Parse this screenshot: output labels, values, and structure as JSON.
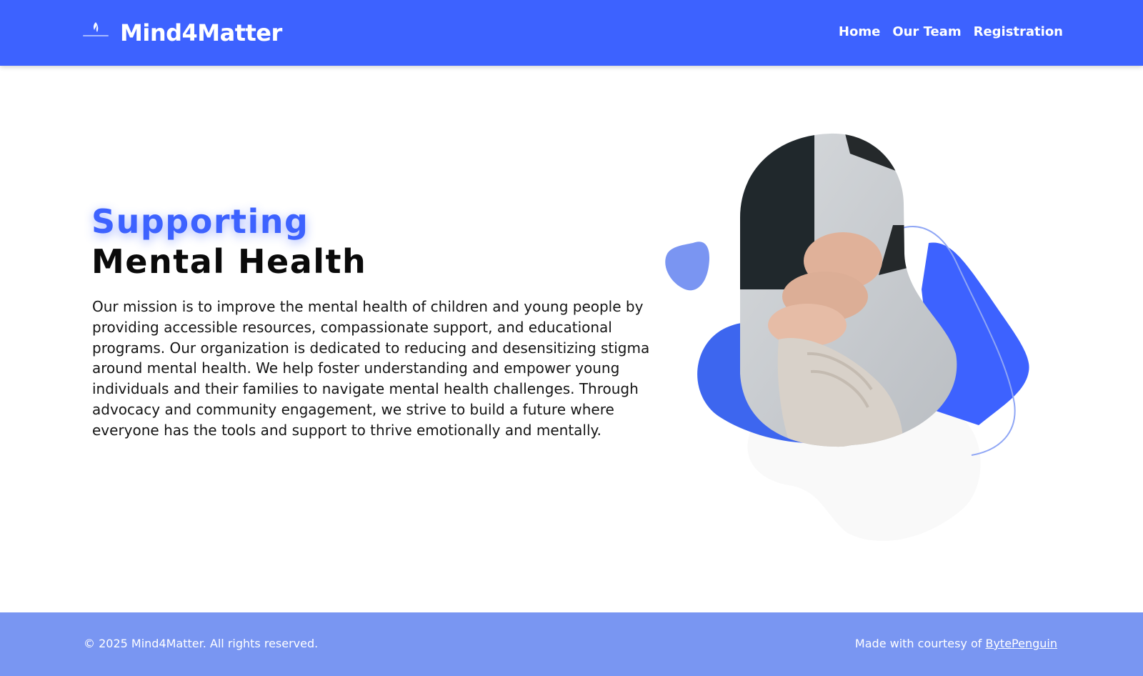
{
  "header": {
    "brand": "Mind4Matter",
    "logo_icon": "mind4matter-logo",
    "nav": [
      {
        "label": "Home"
      },
      {
        "label": "Our Team"
      },
      {
        "label": "Registration"
      }
    ]
  },
  "hero": {
    "line1": "Supporting",
    "line2": "Mental Health",
    "mission": "Our mission is to improve the mental health of children and young people by providing accessible resources, compassionate support, and educational programs. Our organization is dedicated to reducing and desensitizing stigma around mental health. We help foster understanding and empower young individuals and their families to navigate mental health challenges. Through advocacy and community engagement, we strive to build a future where everyone has the tools and support to thrive emotionally and mentally.",
    "image_subject": "stacked-hands-photo"
  },
  "footer": {
    "copyright": "© 2025 Mind4Matter. All rights reserved.",
    "credit_prefix": "Made with courtesy of",
    "credit_link": "BytePenguin"
  },
  "colors": {
    "accent": "#3d62ff",
    "footer_bg": "#7996f2",
    "blob_light": "#7a95f2",
    "text": "#141414"
  }
}
